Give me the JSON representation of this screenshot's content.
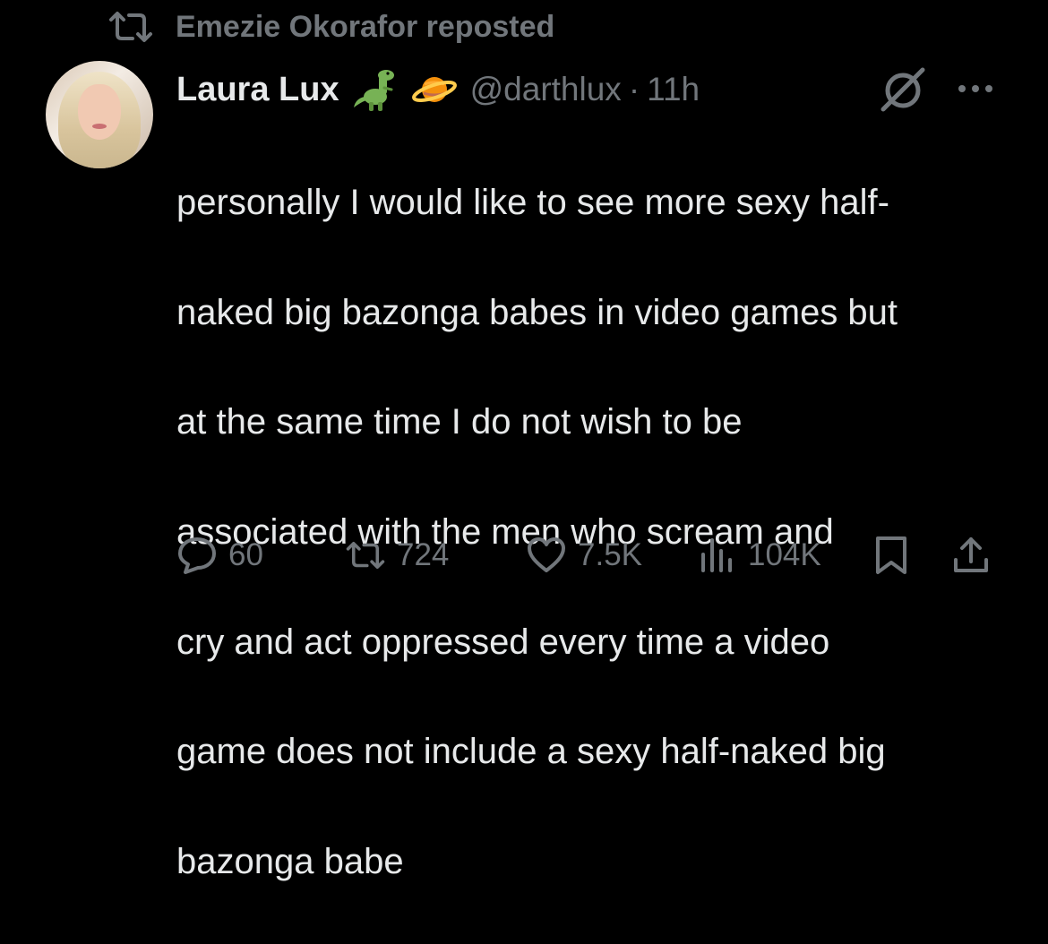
{
  "repost": {
    "icon": "repost-icon",
    "text": "Emezie Okorafor reposted"
  },
  "tweet": {
    "author_name": "Laura Lux",
    "emojis": [
      "dinosaur-emoji",
      "planet-emoji"
    ],
    "handle": "@darthlux",
    "separator": "·",
    "time": "11h",
    "text_lines": [
      "personally I would like to see more sexy half-",
      "naked big bazonga babes in video games but",
      "at the same time I do not wish to be",
      "associated with the men who scream and",
      "cry and act oppressed every time a video",
      "game does not include a sexy half-naked big",
      "bazonga babe"
    ]
  },
  "actions": {
    "replies": "60",
    "reposts": "724",
    "likes": "7.5K",
    "views": "104K"
  },
  "colors": {
    "background": "#000000",
    "text": "#e7e9ea",
    "secondary": "#71767b",
    "accent_blue": "#1d9bf0"
  }
}
